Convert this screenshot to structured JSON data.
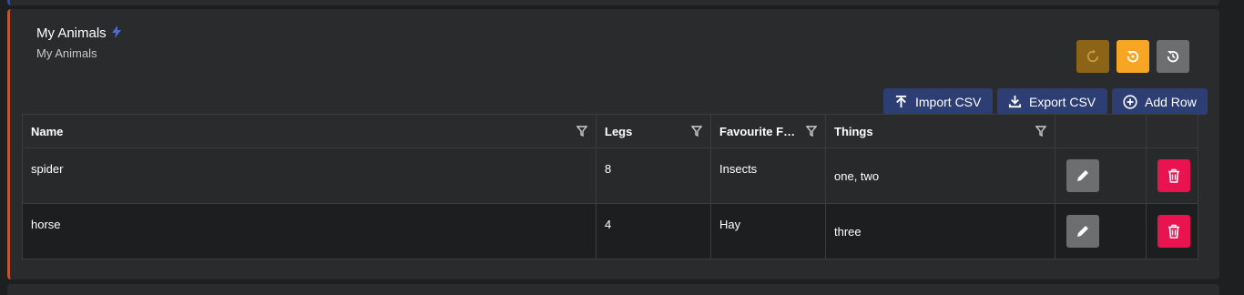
{
  "card": {
    "title": "My Animals",
    "subtitle": "My Animals",
    "accent_color": "#c0572f"
  },
  "header_buttons": [
    {
      "name": "refresh-disabled",
      "icon": "refresh-icon",
      "color": "#8c6418"
    },
    {
      "name": "reset",
      "icon": "reset-icon",
      "color": "#f6a623"
    },
    {
      "name": "history",
      "icon": "history-icon",
      "color": "#6d6e70"
    }
  ],
  "toolbar": {
    "import_label": "Import CSV",
    "export_label": "Export CSV",
    "add_row_label": "Add Row"
  },
  "table": {
    "columns": [
      "Name",
      "Legs",
      "Favourite F…",
      "Things"
    ],
    "rows": [
      {
        "name": "spider",
        "legs": "8",
        "food": "Insects",
        "things": "one, two"
      },
      {
        "name": "horse",
        "legs": "4",
        "food": "Hay",
        "things": "three"
      }
    ]
  },
  "colors": {
    "edit": "#6d6e70",
    "delete": "#e8134f",
    "toolbar_button": "#2c3e73"
  }
}
